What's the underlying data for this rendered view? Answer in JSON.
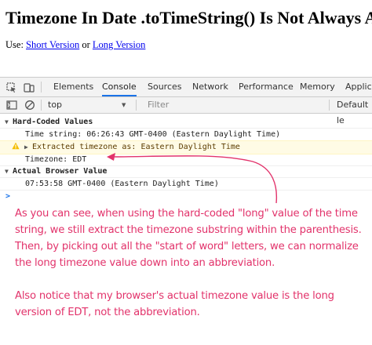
{
  "page": {
    "title": "Timezone In Date .toTimeString() Is Not Always A",
    "use_label": "Use:",
    "short_link": "Short Version",
    "or_text": "or",
    "long_link": "Long Version"
  },
  "devtools": {
    "tabs": [
      "Elements",
      "Console",
      "Sources",
      "Network",
      "Performance",
      "Memory",
      "Applica"
    ],
    "active_tab": "Console",
    "context": "top",
    "filter_placeholder": "Filter",
    "levels": "Default le",
    "accent_color": "#1a73e8"
  },
  "console": {
    "group1_label": "Hard-Coded Values",
    "time_string": "Time string: 06:26:43 GMT-0400 (Eastern Daylight Time)",
    "extracted": "Extracted timezone as: Eastern Daylight Time",
    "timezone": "Timezone: EDT",
    "group2_label": "Actual Browser Value",
    "browser_value": "07:53:58 GMT-0400 (Eastern Daylight Time)",
    "prompt": ">"
  },
  "annotation": {
    "color": "#e2336b",
    "paragraph1": "As you can see, when using the hard-coded \"long\" value of the time string, we still extract the timezone substring within the parenthesis. Then, by picking out all the \"start of word\" letters, we can normalize the long timezone value down into an abbreviation.",
    "paragraph2": "Also notice that my browser's actual timezone value is the long version of EDT, not the abbreviation."
  }
}
